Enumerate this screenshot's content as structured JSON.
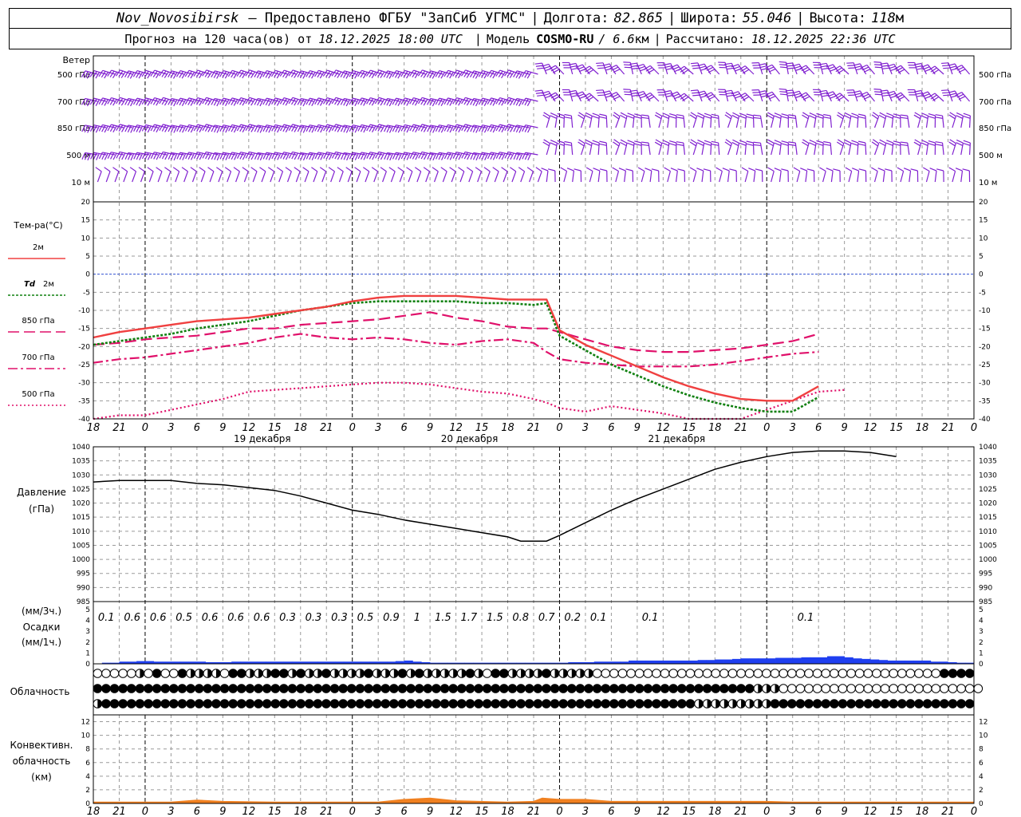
{
  "header": {
    "station": "Nov_Novosibirsk",
    "provider": "– Предоставлено ФГБУ \"ЗапСиб УГМС\"",
    "lon_label": "Долгота:",
    "lon_value": "82.865",
    "lat_label": "Широта:",
    "lat_value": "55.046",
    "alt_label": "Высота:",
    "alt_value": "118",
    "alt_unit": "м",
    "forecast_label": "Прогноз на 120 часа(ов) от",
    "forecast_start": "18.12.2025 18:00 UTC",
    "model_label": "Модель",
    "model_name": "COSMO-RU",
    "model_res": "/ 6.6",
    "model_res_unit": "км",
    "calc_label": "Рассчитано:",
    "calc_time": "18.12.2025 22:36 UTC"
  },
  "colors": {
    "t2m": "#f04040",
    "td2m": "#108010",
    "t850": "#e0106a",
    "t700": "#e0106a",
    "t500": "#e0106a",
    "zero_line": "#3050d0",
    "wind": "#8020d0",
    "precip": "#1f3ff0",
    "convective": "#f08020",
    "pressure": "#000000",
    "grid": "#999999"
  },
  "chart_data": [
    {
      "type": "wind_barbs",
      "panel_label": "Ветер",
      "levels": [
        "500 гПа",
        "700 гПа",
        "850 гПа",
        "500 м",
        "10 м"
      ]
    },
    {
      "type": "line",
      "title": "Тем-ра(°С)",
      "ylim": [
        -40,
        20
      ],
      "yticks": [
        20,
        15,
        10,
        5,
        0,
        -5,
        -10,
        -15,
        -20,
        -25,
        -30,
        -35,
        -40
      ],
      "x_hours": [
        18,
        21,
        24,
        27,
        30,
        33,
        36,
        39,
        42,
        45,
        48,
        51,
        54,
        57,
        60,
        63,
        66,
        69,
        72,
        75,
        78,
        81,
        84,
        87,
        90,
        93,
        96,
        99,
        102,
        105,
        108,
        111,
        114,
        117,
        120
      ],
      "x_tick_labels": [
        "18",
        "21",
        "0",
        "3",
        "6",
        "9",
        "12",
        "15",
        "18",
        "21",
        "0",
        "3",
        "6",
        "9",
        "12",
        "15",
        "18",
        "21",
        "0",
        "3",
        "6",
        "9",
        "12",
        "15",
        "18",
        "21",
        "0",
        "3",
        "6",
        "9",
        "12",
        "15",
        "18",
        "21",
        "0"
      ],
      "day_labels": [
        {
          "hour": 36,
          "text": "19 декабря"
        },
        {
          "hour": 60,
          "text": "20 декабря"
        },
        {
          "hour": 84,
          "text": "21 декабря"
        }
      ],
      "series": [
        {
          "key": "t850",
          "name": "850 гПа",
          "dash": "long",
          "values": [
            -19.5,
            -19.0,
            -18.0,
            -17.5,
            -17.0,
            -16.0,
            -15.0,
            -15.0,
            -14.0,
            -13.5,
            -13.0,
            -12.5,
            -11.5,
            -10.5,
            -12.0,
            -13.0,
            -14.5,
            -15.0,
            -15.0,
            -16.0,
            -18.0,
            -20.0,
            -21.0,
            -21.5,
            -21.5,
            -21.0,
            -20.5,
            -19.5,
            -18.5,
            -16.5
          ]
        },
        {
          "key": "t700",
          "name": "700 гПа",
          "dash": "dashdot",
          "values": [
            -24.5,
            -23.5,
            -23.0,
            -22.0,
            -21.0,
            -20.0,
            -19.0,
            -17.5,
            -16.5,
            -17.5,
            -18.0,
            -17.5,
            -18.0,
            -19.0,
            -19.5,
            -18.5,
            -18.0,
            -19.0,
            -21.5,
            -23.5,
            -24.5,
            -25.0,
            -25.5,
            -25.5,
            -25.5,
            -25.0,
            -24.0,
            -23.0,
            -22.0,
            -21.5
          ]
        },
        {
          "key": "t500",
          "name": "500 гПа",
          "dash": "dot",
          "values": [
            -40.0,
            -39.0,
            -39.0,
            -37.5,
            -36.0,
            -34.5,
            -32.5,
            -32.0,
            -31.5,
            -31.0,
            -30.5,
            -30.0,
            -30.0,
            -30.5,
            -31.5,
            -32.5,
            -33.0,
            -34.5,
            -35.5,
            -37.0,
            -38.0,
            -36.5,
            -37.5,
            -38.5,
            -40.0,
            -41.0,
            -40.5,
            -37.5,
            -35.0,
            -32.5,
            -32.0
          ]
        },
        {
          "key": "td2m",
          "name": "Td 2м",
          "dash": "dense",
          "values": [
            -19.5,
            -18.5,
            -17.5,
            -16.5,
            -15.0,
            -14.0,
            -13.0,
            -11.5,
            -10.0,
            -9.0,
            -8.0,
            -7.5,
            -7.5,
            -7.5,
            -7.5,
            -8.0,
            -8.0,
            -8.5,
            -8.0,
            -17.0,
            -21.0,
            -25.0,
            -28.0,
            -31.0,
            -33.5,
            -35.5,
            -37.0,
            -38.0,
            -38.0,
            -34.0
          ]
        },
        {
          "key": "t2m",
          "name": "2м",
          "dash": "solid",
          "values": [
            -17.5,
            -16.0,
            -15.0,
            -14.0,
            -13.0,
            -12.5,
            -12.0,
            -11.0,
            -10.0,
            -9.0,
            -7.5,
            -6.5,
            -6.0,
            -6.0,
            -6.0,
            -6.5,
            -7.0,
            -7.0,
            -7.0,
            -15.5,
            -19.5,
            -22.5,
            -25.5,
            -28.5,
            -31.0,
            -33.0,
            -34.5,
            -35.0,
            -35.0,
            -31.0
          ]
        }
      ],
      "series_hours": [
        18,
        21,
        24,
        27,
        30,
        33,
        36,
        39,
        42,
        45,
        48,
        51,
        54,
        57,
        60,
        63,
        66,
        69,
        70.5,
        72,
        75,
        78,
        81,
        84,
        87,
        90,
        93,
        96,
        99,
        102,
        105,
        108,
        111,
        114,
        117,
        120
      ]
    },
    {
      "type": "line",
      "title": "Давление",
      "unit": "(гПа)",
      "ylim": [
        985,
        1040
      ],
      "yticks": [
        1040,
        1035,
        1030,
        1025,
        1020,
        1015,
        1010,
        1005,
        1000,
        995,
        990,
        985
      ],
      "hours": [
        18,
        21,
        24,
        27,
        30,
        33,
        36,
        39,
        42,
        45,
        48,
        51,
        54,
        57,
        60,
        63,
        66,
        67.5,
        69,
        70.5,
        72,
        75,
        78,
        81,
        84,
        87,
        90,
        93,
        96,
        99,
        102,
        105,
        108,
        111,
        114,
        117,
        120
      ],
      "values": [
        1027.5,
        1028.0,
        1028.0,
        1028.0,
        1027.0,
        1026.5,
        1025.5,
        1024.5,
        1022.5,
        1020.0,
        1017.5,
        1016.0,
        1014.0,
        1012.5,
        1011.0,
        1009.5,
        1008.0,
        1006.5,
        1006.5,
        1006.5,
        1008.5,
        1013.0,
        1017.5,
        1021.5,
        1025.0,
        1028.5,
        1032.0,
        1034.5,
        1036.5,
        1038.0,
        1038.5,
        1038.5,
        1038.0,
        1036.5
      ]
    },
    {
      "type": "bar",
      "title": "Осадки",
      "unit_3h": "(мм/3ч.)",
      "unit_1h": "(мм/1ч.)",
      "ylim": [
        0,
        5
      ],
      "yticks": [
        5,
        4,
        3,
        2,
        1,
        0
      ],
      "totals_3h": [
        {
          "hour": 19.5,
          "text": "0.1"
        },
        {
          "hour": 22.5,
          "text": "0.6"
        },
        {
          "hour": 25.5,
          "text": "0.6"
        },
        {
          "hour": 28.5,
          "text": "0.5"
        },
        {
          "hour": 31.5,
          "text": "0.6"
        },
        {
          "hour": 34.5,
          "text": "0.6"
        },
        {
          "hour": 37.5,
          "text": "0.6"
        },
        {
          "hour": 40.5,
          "text": "0.3"
        },
        {
          "hour": 43.5,
          "text": "0.3"
        },
        {
          "hour": 46.5,
          "text": "0.3"
        },
        {
          "hour": 49.5,
          "text": "0.5"
        },
        {
          "hour": 52.5,
          "text": "0.9"
        },
        {
          "hour": 55.5,
          "text": "1"
        },
        {
          "hour": 58.5,
          "text": "1.5"
        },
        {
          "hour": 61.5,
          "text": "1.7"
        },
        {
          "hour": 64.5,
          "text": "1.5"
        },
        {
          "hour": 67.5,
          "text": "0.8"
        },
        {
          "hour": 70.5,
          "text": "0.7"
        },
        {
          "hour": 73.5,
          "text": "0.2"
        },
        {
          "hour": 76.5,
          "text": "0.1"
        },
        {
          "hour": 82.5,
          "text": "0.1"
        },
        {
          "hour": 100.5,
          "text": "0.1"
        }
      ],
      "hourly_mm": [
        0,
        0.1,
        0.1,
        0.2,
        0.2,
        0.25,
        0.25,
        0.2,
        0.2,
        0.2,
        0.2,
        0.2,
        0.2,
        0.15,
        0.15,
        0.15,
        0.2,
        0.2,
        0.2,
        0.2,
        0.2,
        0.2,
        0.2,
        0.2,
        0.2,
        0.2,
        0.2,
        0.2,
        0.2,
        0.2,
        0.2,
        0.2,
        0.2,
        0.2,
        0.2,
        0.25,
        0.3,
        0.2,
        0.15,
        0.1,
        0.1,
        0.1,
        0.1,
        0.1,
        0.1,
        0.1,
        0.1,
        0.1,
        0.1,
        0.1,
        0.1,
        0.1,
        0.1,
        0.1,
        0.1,
        0.15,
        0.15,
        0.15,
        0.2,
        0.2,
        0.2,
        0.2,
        0.3,
        0.3,
        0.3,
        0.3,
        0.3,
        0.3,
        0.3,
        0.3,
        0.35,
        0.35,
        0.4,
        0.4,
        0.45,
        0.5,
        0.5,
        0.5,
        0.5,
        0.55,
        0.55,
        0.55,
        0.6,
        0.6,
        0.6,
        0.7,
        0.7,
        0.6,
        0.5,
        0.45,
        0.4,
        0.35,
        0.3,
        0.3,
        0.3,
        0.3,
        0.3,
        0.2,
        0.2,
        0.15,
        0.1,
        0.1,
        0.1,
        0.05,
        0.05,
        0.05,
        0.05,
        0.05,
        0.05,
        0.05,
        0,
        0,
        0,
        0,
        0,
        0,
        0,
        0.03,
        0.03,
        0.03,
        0
      ],
      "hourly_start_hour": 18
    },
    {
      "type": "symbols",
      "title": "Облачность",
      "rows": [
        "ooooohodoodhhhhoddhhhddhdhhdhhhhdhhhdhdhhhhhdhoddhhhhdhhhhhooooooooooooooooooooooooooooooooooooooooodddd",
        "ddddddddddddddddddddddddddddddddddddddddddddddddddddddddddddddddddddddddddddddhhhoooooooooooooooooooooooo",
        "hddddddddddddddddddddddddddddddddddddddddddddddddddddddddddddddddddddddhhhhhhhhhdddddddddddddddddddddddd"
      ]
    },
    {
      "type": "area",
      "title": "Конвективн. облачность",
      "unit": "(км)",
      "ylim": [
        0,
        13
      ],
      "yticks": [
        12,
        10,
        8,
        6,
        4,
        2,
        0
      ],
      "hours": [
        18,
        27,
        30,
        33,
        39,
        51,
        54,
        57,
        60,
        66,
        69,
        70,
        72,
        75,
        78,
        84,
        90,
        96,
        99,
        102,
        120
      ],
      "values": [
        0.2,
        0.2,
        0.5,
        0.3,
        0.2,
        0.2,
        0.6,
        0.8,
        0.4,
        0.2,
        0.3,
        0.8,
        0.6,
        0.6,
        0.3,
        0.3,
        0.3,
        0.3,
        0.2,
        0.2,
        0.2
      ]
    }
  ],
  "legend": {
    "t2m": "2м",
    "td2m_prefix": "Td",
    "td2m": "2м",
    "t850": "850 гПа",
    "t700": "700 гПа",
    "t500": "500 гПа"
  }
}
